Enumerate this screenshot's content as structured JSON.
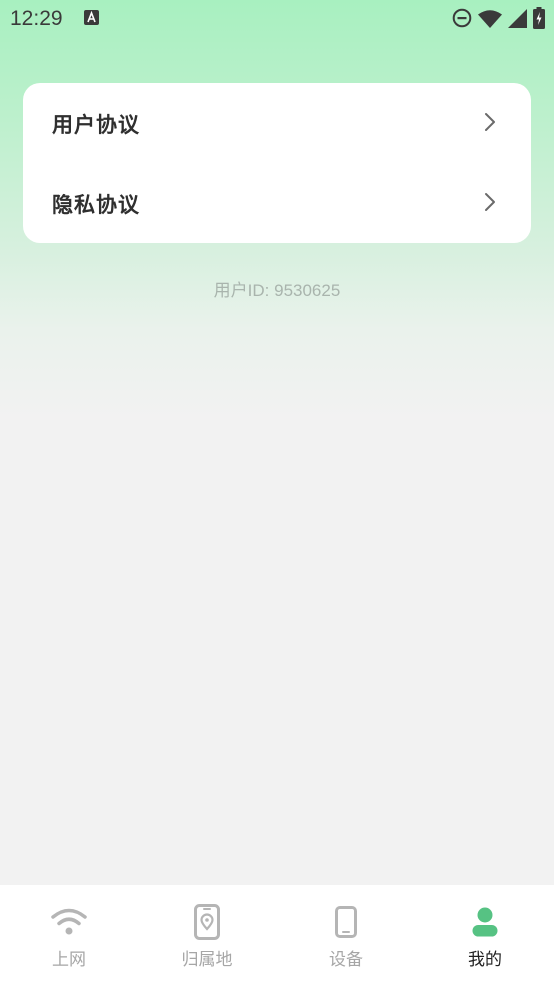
{
  "status_bar": {
    "time": "12:29",
    "notification_icon": "a-notification-icon",
    "icons": [
      "do-not-disturb-icon",
      "wifi-signal-icon",
      "cell-signal-icon",
      "battery-charging-icon"
    ]
  },
  "menu": {
    "items": [
      {
        "label": "用户协议",
        "icon": "chevron-right-icon"
      },
      {
        "label": "隐私协议",
        "icon": "chevron-right-icon"
      }
    ]
  },
  "user_id": "用户ID: 9530625",
  "tab_bar": {
    "tabs": [
      {
        "label": "上网",
        "icon": "wifi-icon",
        "active": false
      },
      {
        "label": "归属地",
        "icon": "phone-location-icon",
        "active": false
      },
      {
        "label": "设备",
        "icon": "phone-device-icon",
        "active": false
      },
      {
        "label": "我的",
        "icon": "person-icon",
        "active": true
      }
    ]
  },
  "colors": {
    "accent": "#56c283",
    "inactive_tab": "#a6a6a6",
    "active_tab_text": "#1f1f1f",
    "gradient_top": "#a8f0c0",
    "background": "#f2f2f2"
  }
}
